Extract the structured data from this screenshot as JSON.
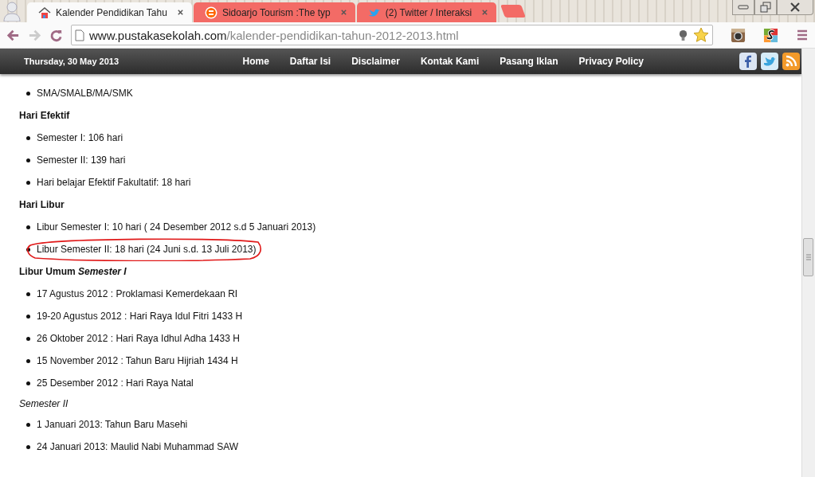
{
  "browser": {
    "tabs": [
      {
        "title": "Kalender Pendidikan Tahu",
        "selected": true
      },
      {
        "title": "Sidoarjo Tourism :The typ",
        "selected": false
      },
      {
        "title": "(2) Twitter / Interaksi",
        "selected": false
      }
    ],
    "address": {
      "domain": "www.pustakasekolah.com",
      "path": "/kalender-pendidikan-tahun-2012-2013.html"
    }
  },
  "site_header": {
    "date": "Thursday, 30 May 2013",
    "nav": [
      "Home",
      "Daftar Isi",
      "Disclaimer",
      "Kontak Kami",
      "Pasang Iklan",
      "Privacy Policy"
    ]
  },
  "content": [
    {
      "kind": "bullet",
      "text": "SMA/SMALB/MA/SMK"
    },
    {
      "kind": "heading",
      "text": "Hari Efektif"
    },
    {
      "kind": "bullet",
      "text": "Semester I: 106 hari"
    },
    {
      "kind": "bullet",
      "text": "Semester II: 139 hari"
    },
    {
      "kind": "bullet",
      "text": "Hari belajar Efektif Fakultatif: 18 hari"
    },
    {
      "kind": "heading",
      "text": "Hari Libur"
    },
    {
      "kind": "bullet",
      "text": "Libur Semester I: 10 hari ( 24 Desember 2012 s.d 5 Januari 2013)"
    },
    {
      "kind": "bullet",
      "text": "Libur Semester II: 18 hari (24 Juni s.d. 13 Juli 2013)",
      "circled": true
    },
    {
      "kind": "heading",
      "text": "Libur Umum *Semester I*"
    },
    {
      "kind": "bullet",
      "text": "17 Agustus 2012 : Proklamasi Kemerdekaan RI"
    },
    {
      "kind": "bullet",
      "text": "19-20 Agustus 2012 : Hari Raya Idul Fitri 1433 H"
    },
    {
      "kind": "bullet",
      "text": "26 Oktober 2012 : Hari Raya Idhul Adha 1433 H"
    },
    {
      "kind": "bullet",
      "text": "15 November 2012 : Tahun Baru Hijriah 1434 H"
    },
    {
      "kind": "bullet",
      "text": "25 Desember 2012 : Hari Raya Natal"
    },
    {
      "kind": "subheading",
      "text": "Semester II"
    },
    {
      "kind": "bullet",
      "text": "1 Januari 2013: Tahun Baru Masehi"
    },
    {
      "kind": "bullet",
      "text": "24 Januari 2013: Maulid Nabi Muhammad SAW"
    }
  ]
}
